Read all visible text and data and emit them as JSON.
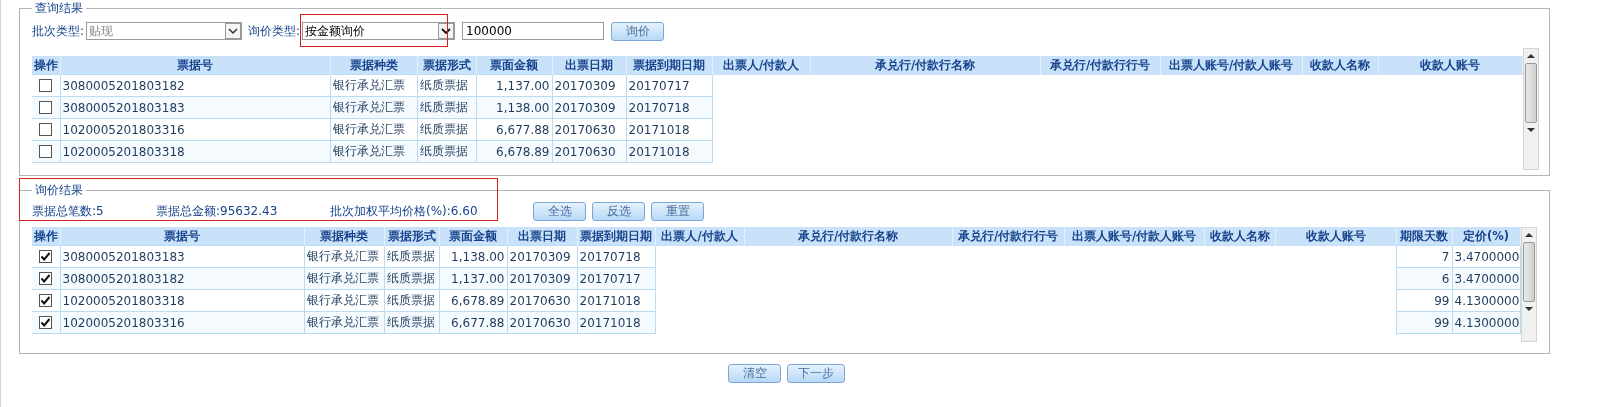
{
  "query_section": {
    "legend": "查询结果",
    "batch_type": {
      "label": "批次类型:",
      "value": "贴现"
    },
    "inquiry_type": {
      "label": "询价类型:",
      "value": "按金额询价"
    },
    "amount": {
      "value": "100000"
    },
    "inquire_button": "询价",
    "table": {
      "action_header": "操作",
      "columns": [
        "票据号",
        "票据种类",
        "票据形式",
        "票面金额",
        "出票日期",
        "票据到期日期",
        "出票人/付款人",
        "承兑行/付款行名称",
        "承兑行/付款行行号",
        "出票人账号/付款人账号",
        "收款人名称",
        "收款人账号"
      ],
      "rows": [
        {
          "checked": false,
          "cells": [
            "3080005201803182",
            "银行承兑汇票",
            "纸质票据",
            "1,137.00",
            "20170309",
            "20170717"
          ]
        },
        {
          "checked": false,
          "cells": [
            "3080005201803183",
            "银行承兑汇票",
            "纸质票据",
            "1,138.00",
            "20170309",
            "20170718"
          ]
        },
        {
          "checked": false,
          "cells": [
            "1020005201803316",
            "银行承兑汇票",
            "纸质票据",
            "6,677.88",
            "20170630",
            "20171018"
          ]
        },
        {
          "checked": false,
          "cells": [
            "1020005201803318",
            "银行承兑汇票",
            "纸质票据",
            "6,678.89",
            "20170630",
            "20171018"
          ]
        }
      ]
    }
  },
  "result_section": {
    "legend": "询价结果",
    "summary": [
      "票据总笔数:5",
      "票据总金额:95632.43",
      "批次加权平均价格(%):6.60"
    ],
    "buttons": [
      "全选",
      "反选",
      "重置"
    ],
    "table": {
      "action_header": "操作",
      "columns": [
        "票据号",
        "票据种类",
        "票据形式",
        "票面金额",
        "出票日期",
        "票据到期日期",
        "出票人/付款人",
        "承兑行/付款行名称",
        "承兑行/付款行行号",
        "出票人账号/付款人账号",
        "收款人名称",
        "收款人账号",
        "期限天数",
        "定价(%)"
      ],
      "rows": [
        {
          "checked": true,
          "cells": [
            "3080005201803183",
            "银行承兑汇票",
            "纸质票据",
            "1,138.00",
            "20170309",
            "20170718"
          ],
          "term_days": "7",
          "price": "3.4700000"
        },
        {
          "checked": true,
          "cells": [
            "3080005201803182",
            "银行承兑汇票",
            "纸质票据",
            "1,137.00",
            "20170309",
            "20170717"
          ],
          "term_days": "6",
          "price": "3.4700000"
        },
        {
          "checked": true,
          "cells": [
            "1020005201803318",
            "银行承兑汇票",
            "纸质票据",
            "6,678.89",
            "20170630",
            "20171018"
          ],
          "term_days": "99",
          "price": "4.1300000"
        },
        {
          "checked": true,
          "cells": [
            "1020005201803316",
            "银行承兑汇票",
            "纸质票据",
            "6,677.88",
            "20170630",
            "20171018"
          ],
          "term_days": "99",
          "price": "4.1300000"
        }
      ]
    }
  },
  "footer_buttons": [
    "清空",
    "下一步"
  ]
}
